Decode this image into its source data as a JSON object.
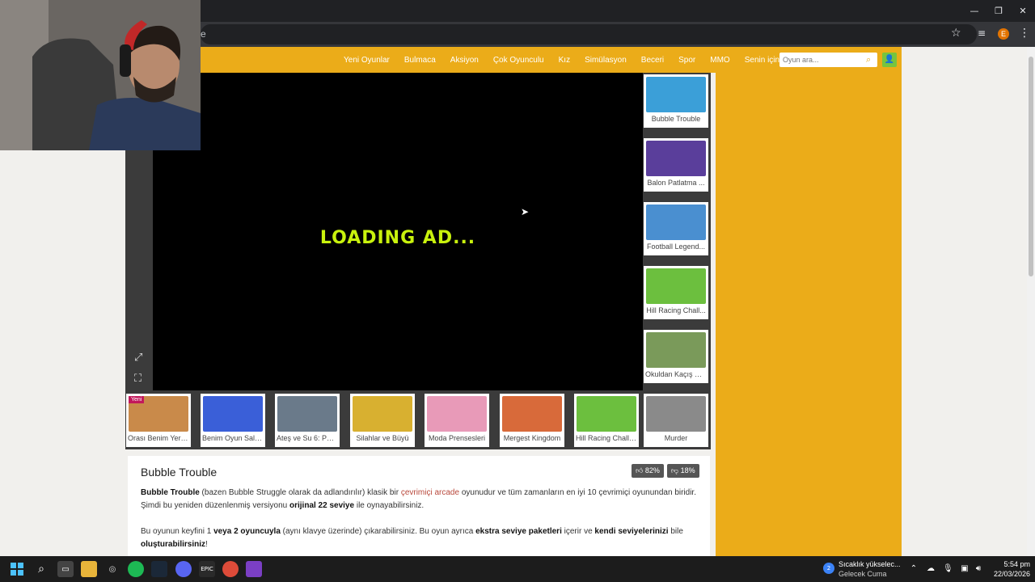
{
  "browser": {
    "address_text": "e",
    "window_controls": [
      "—",
      "❐",
      "✕"
    ],
    "profile_initial": "E"
  },
  "site": {
    "nav_items": [
      "Yeni Oyunlar",
      "Bulmaca",
      "Aksiyon",
      "Çok Oyunculu",
      "Kız",
      "Simülasyon",
      "Beceri",
      "Spor",
      "MMO",
      "Senin için"
    ],
    "search_placeholder": "Oyun ara...",
    "accent_color": "#ebac19"
  },
  "game": {
    "loading_text": "LOADING AD..."
  },
  "side_games": [
    {
      "label": "Bubble Trouble",
      "color": "#3b9fd8"
    },
    {
      "label": "Balon Patlatma ...",
      "color": "#5a3e9b"
    },
    {
      "label": "Football Legend...",
      "color": "#4a8fd0"
    },
    {
      "label": "Hill Racing Chall...",
      "color": "#6cbf3e"
    },
    {
      "label": "Okuldan Kaçış M...",
      "color": "#7a9a5a"
    }
  ],
  "bottom_games": [
    {
      "label": "Orası Benim Yerim!",
      "color": "#c98a4a",
      "badge": "Yeni"
    },
    {
      "label": "Benim Oyun Salo...",
      "color": "#3a5fd8"
    },
    {
      "label": "Ateş ve Su 6: Peri ...",
      "color": "#6a7a8a"
    },
    {
      "label": "Silahlar ve Büyü",
      "color": "#d8b030"
    },
    {
      "label": "Moda Prensesleri",
      "color": "#e89ab8"
    },
    {
      "label": "Mergest Kingdom",
      "color": "#d86a3a"
    },
    {
      "label": "Hill Racing Challe...",
      "color": "#6cbf3e"
    },
    {
      "label": "Murder",
      "color": "#8a8a8a"
    }
  ],
  "description": {
    "title": "Bubble Trouble",
    "like_pct": "82%",
    "dislike_pct": "18%",
    "p1_bold1": "Bubble Trouble",
    "p1_t1": " (bazen Bubble Struggle olarak da adlandırılır) klasik bir ",
    "p1_link": "çevrimiçi arcade",
    "p1_t2": " oyunudur ve tüm zamanların en iyi 10 çevrimiçi oyunundan biridir. Şimdi bu yeniden düzenlenmiş versiyonu ",
    "p1_bold2": "orijinal 22 seviye",
    "p1_t3": " ile oynayabilirsiniz.",
    "p2_t1": "Bu oyunun keyfini 1 ",
    "p2_bold1": "veya 2 oyuncuyla",
    "p2_t2": " (aynı klavye üzerinde) çıkarabilirsiniz. Bu oyun ayrıca ",
    "p2_bold2": "ekstra seviye paketleri",
    "p2_t3": " içerir ve ",
    "p2_bold3": "kendi seviyelerinizi",
    "p2_t4": " bile ",
    "p2_bold4": "oluşturabilirsiniz",
    "p2_t5": "!"
  },
  "taskbar": {
    "weather_title": "Sıcaklık yükselec...",
    "weather_sub": "Gelecek Cuma",
    "weather_badge": "2",
    "time": "5:54 pm",
    "date": "22/03/2026"
  }
}
